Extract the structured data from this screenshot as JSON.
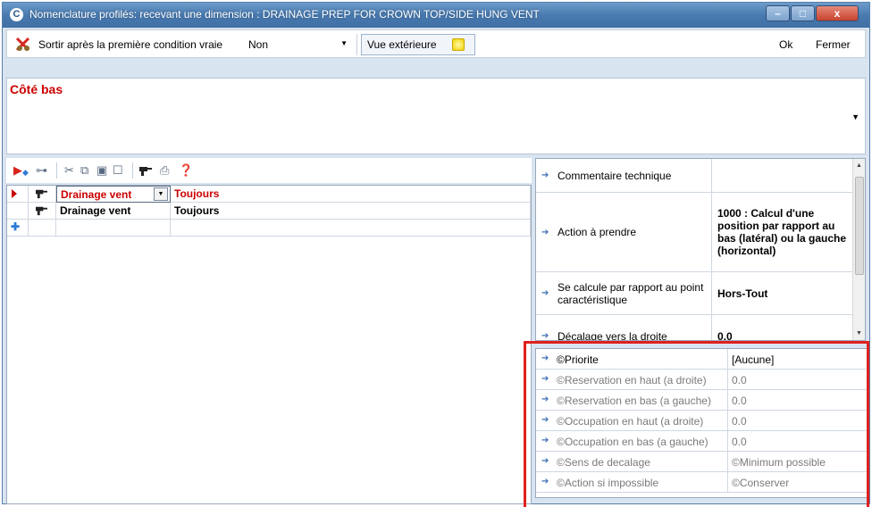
{
  "window": {
    "title": "Nomenclature profilés: recevant une dimension : DRAINAGE PREP FOR CROWN TOP/SIDE HUNG VENT",
    "app_icon": "C",
    "minimize": "–",
    "maximize": "□",
    "close": "x"
  },
  "toolbar": {
    "exit_icon": "scissors-x-icon",
    "exit_label": "Sortir après la première condition vraie",
    "exit_value": "Non",
    "view_label": "Vue extérieure",
    "ok_label": "Ok",
    "close_label": "Fermer"
  },
  "condition": {
    "text": "Côté bas"
  },
  "grid": {
    "rows": [
      {
        "name": "Drainage vent",
        "condition": "Toujours",
        "active": true
      },
      {
        "name": "Drainage vent",
        "condition": "Toujours",
        "active": false
      }
    ]
  },
  "properties": [
    {
      "label": "Commentaire technique",
      "value": ""
    },
    {
      "label": "Action à prendre",
      "value": "1000 : Calcul d'une position par rapport au bas (latéral) ou la gauche (horizontal)"
    },
    {
      "label": "Se calcule par rapport au point caractéristique",
      "value": "Hors-Tout"
    },
    {
      "label": "Décalage vers la droite",
      "value": "0.0"
    }
  ],
  "parameters": [
    {
      "label": "©Priorite",
      "value": "[Aucune]"
    },
    {
      "label": "©Reservation en haut (a droite)",
      "value": "0.0"
    },
    {
      "label": "©Reservation en bas (a gauche)",
      "value": "0.0"
    },
    {
      "label": "©Occupation en haut (a droite)",
      "value": "0.0"
    },
    {
      "label": "©Occupation en bas (a gauche)",
      "value": "0.0"
    },
    {
      "label": "©Sens de decalage",
      "value": "©Minimum possible"
    },
    {
      "label": "©Action si impossible",
      "value": "©Conserver"
    }
  ],
  "colors": {
    "highlight_red": "#cc0000",
    "annotation_box": "#e0201c",
    "title_blue": "#4a7bb0"
  }
}
